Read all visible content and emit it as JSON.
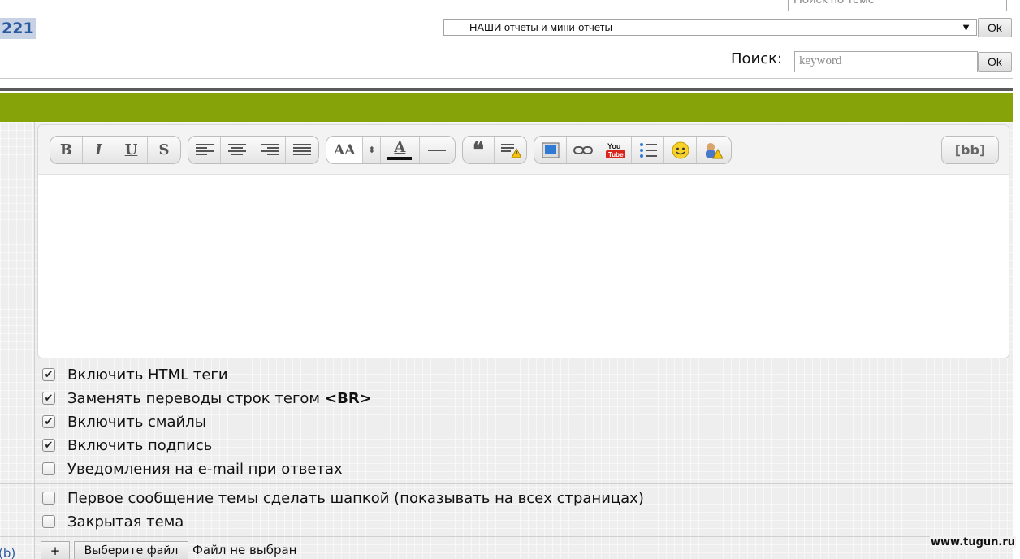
{
  "header": {
    "topic_search_placeholder": "Поиск по теме",
    "page_count": "221",
    "forum_select_value": "НАШИ отчеты и мини-отчеты",
    "ok_label": "Ok",
    "search_label": "Поиск:",
    "search_placeholder": "keyword"
  },
  "editor": {
    "toolbar": {
      "bold": "B",
      "italic": "I",
      "underline": "U",
      "strike": "S",
      "font_size": "AA",
      "font_color": "A",
      "quote": "66",
      "bb_toggle": "[bb]"
    },
    "icons": [
      "bold-icon",
      "italic-icon",
      "underline-icon",
      "strikethrough-icon",
      "align-left-icon",
      "align-center-icon",
      "align-right-icon",
      "align-justify-icon",
      "font-size-icon",
      "font-color-icon",
      "horizontal-rule-icon",
      "quote-icon",
      "spoiler-icon",
      "image-icon",
      "link-icon",
      "youtube-icon",
      "list-icon",
      "smiley-icon",
      "offtopic-icon"
    ]
  },
  "options": [
    {
      "label": "Включить HTML теги",
      "checked": true
    },
    {
      "label": "Заменять переводы строк тегом",
      "extra": "<BR>",
      "checked": true
    },
    {
      "label": "Включить смайлы",
      "checked": true
    },
    {
      "label": "Включить подпись",
      "checked": true
    },
    {
      "label": "Уведомления на e-mail при ответах",
      "checked": false
    }
  ],
  "options2": [
    {
      "label": "Первое сообщение темы сделать шапкой (показывать на всех страницах)",
      "checked": false
    },
    {
      "label": "Закрытая тема",
      "checked": false
    }
  ],
  "attach": {
    "left_text": "(b)",
    "plus_label": "+",
    "choose_file_label": "Выберите файл",
    "file_status": "Файл не выбран"
  },
  "watermark": "www.tugun.ru",
  "colors": {
    "green_bar": "#86a30a",
    "page_count_bg": "#c7d2e4",
    "page_count_text": "#2a5aa0"
  }
}
